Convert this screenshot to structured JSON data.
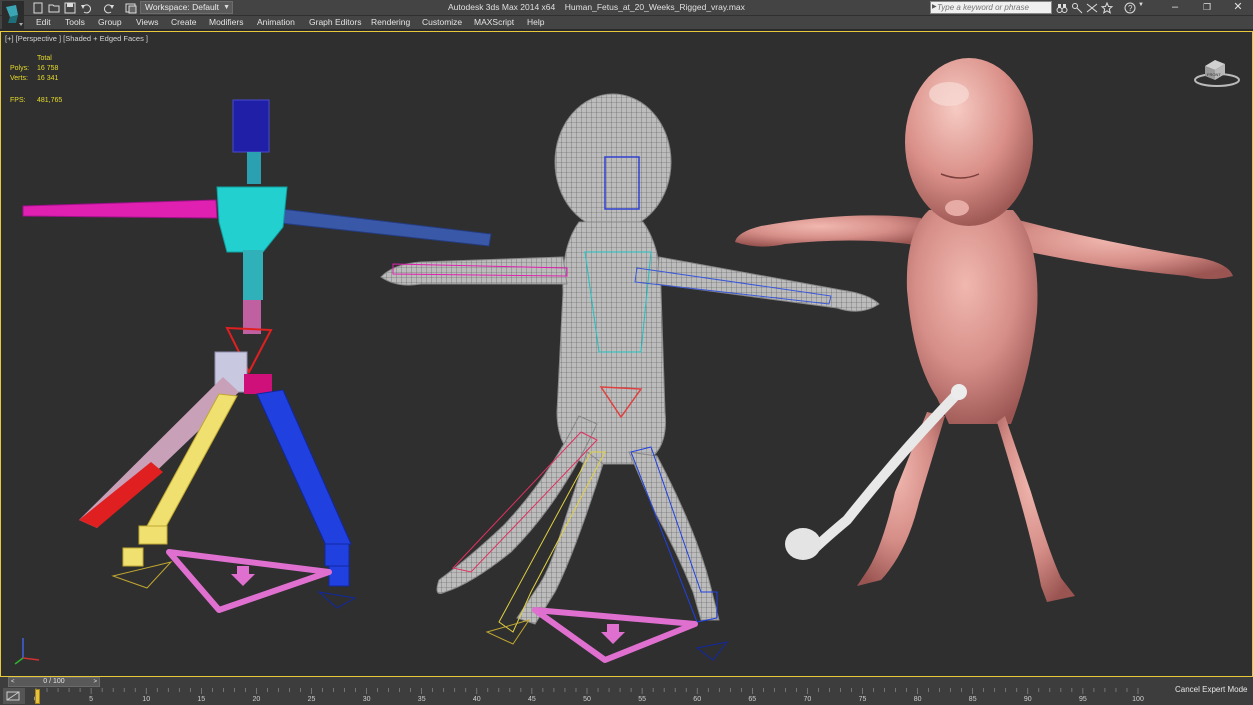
{
  "titlebar": {
    "workspace_label": "Workspace: Default",
    "app_title": "Autodesk 3ds Max  2014 x64",
    "file_name": "Human_Fetus_at_20_Weeks_Rigged_vray.max",
    "search_placeholder": "Type a keyword or phrase",
    "icons": [
      "app-logo-icon",
      "new-file-icon",
      "open-file-icon",
      "save-icon",
      "undo-icon",
      "redo-icon",
      "project-folder-icon",
      "binoculars-icon",
      "key-icon",
      "favorites-icon",
      "help-icon"
    ],
    "window_controls": [
      "minimize",
      "restore",
      "close"
    ]
  },
  "menubar": {
    "items": [
      {
        "label": "Edit"
      },
      {
        "label": "Tools"
      },
      {
        "label": "Group"
      },
      {
        "label": "Views"
      },
      {
        "label": "Create"
      },
      {
        "label": "Modifiers"
      },
      {
        "label": "Animation"
      },
      {
        "label": "Graph Editors"
      },
      {
        "label": "Rendering"
      },
      {
        "label": "Customize"
      },
      {
        "label": "MAXScript"
      },
      {
        "label": "Help"
      }
    ]
  },
  "viewport": {
    "label": "[+] [Perspective ] [Shaded + Edged Faces ]",
    "stats": {
      "header": "Total",
      "polys_label": "Polys:",
      "polys_value": "16 758",
      "verts_label": "Verts:",
      "verts_value": "16 341",
      "fps_label": "FPS:",
      "fps_value": "481,765"
    },
    "viewcube_label": "FRONT",
    "border_color": "#e8c83c",
    "stats_color": "#e8dc2a"
  },
  "timeline": {
    "frame_counter": "0 / 100",
    "prev_symbol": "<",
    "next_symbol": ">",
    "ticks": [
      "0",
      "5",
      "10",
      "15",
      "20",
      "25",
      "30",
      "35",
      "40",
      "45",
      "50",
      "55",
      "60",
      "65",
      "70",
      "75",
      "80",
      "85",
      "90",
      "95",
      "100"
    ],
    "current_frame": 0
  },
  "status": {
    "cancel_expert_label": "Cancel Expert Mode"
  }
}
